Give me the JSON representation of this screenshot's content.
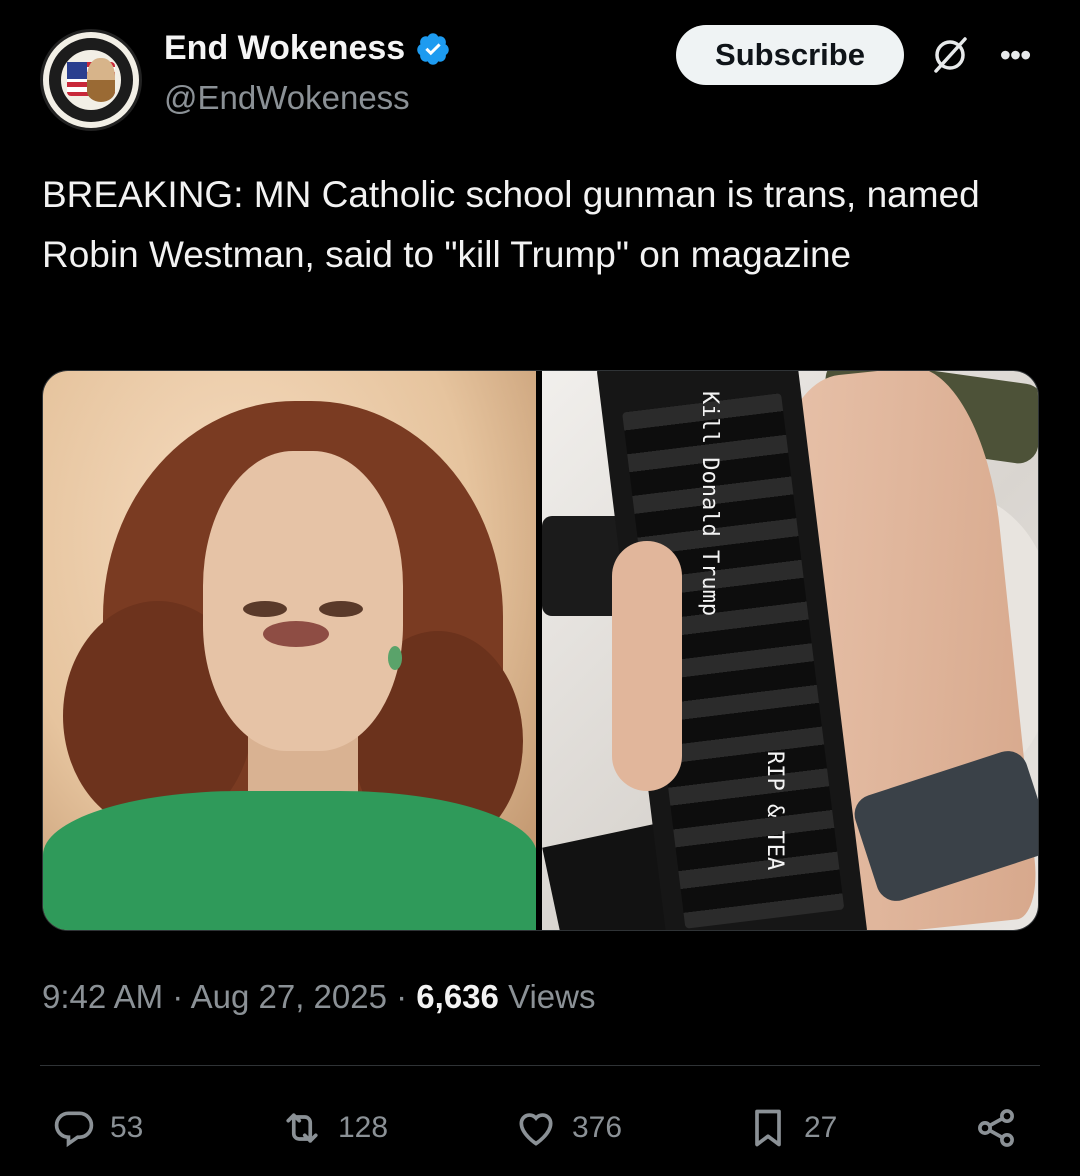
{
  "author": {
    "display_name": "End Wokeness",
    "handle": "@EndWokeness",
    "verified": true,
    "avatar_icon": "support-the-former-things-badge"
  },
  "header": {
    "subscribe_label": "Subscribe",
    "grok_icon": "grok-icon",
    "more_icon": "more-icon"
  },
  "tweet": {
    "text": "BREAKING: MN Catholic school gunman is trans, named Robin Westman, said to \"kill Trump\" on magazine",
    "media_text": {
      "line1": "Kill Donald Trump",
      "line2": "RIP & TEA"
    }
  },
  "meta": {
    "time": "9:42 AM",
    "date": "Aug 27, 2025",
    "separator": "·",
    "views_count": "6,636",
    "views_label": "Views"
  },
  "actions": {
    "replies": "53",
    "reposts": "128",
    "likes": "376",
    "bookmarks": "27"
  },
  "colors": {
    "background": "#000000",
    "text_primary": "#e7e9ea",
    "text_secondary": "#8b9196",
    "verified_blue": "#1d9bf0",
    "subscribe_bg": "#eff3f4"
  }
}
